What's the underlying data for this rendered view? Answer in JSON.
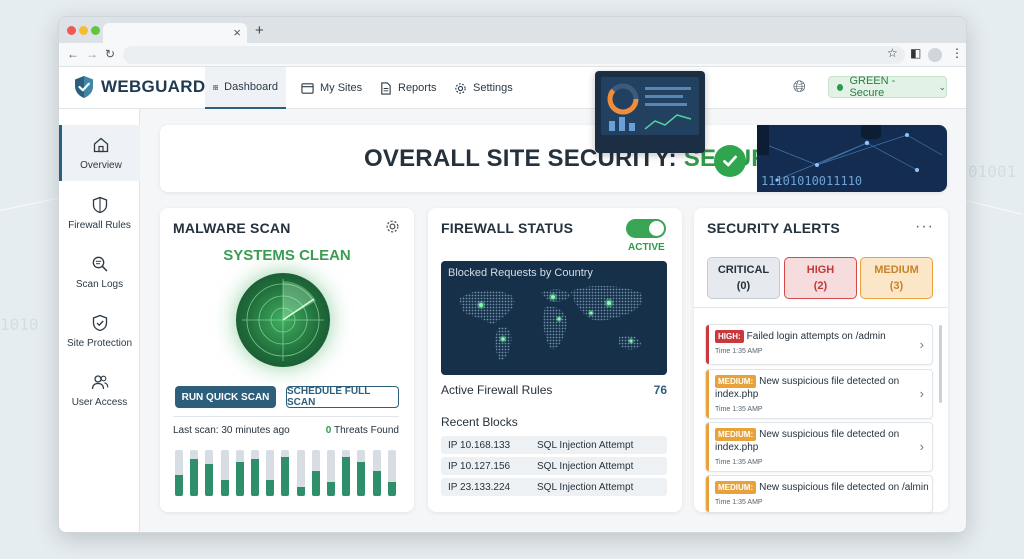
{
  "browser": {
    "tab_close": "×",
    "new_tab": "+"
  },
  "nav": {
    "brand": "WEBGUARD",
    "items": [
      {
        "label": "Dashboard"
      },
      {
        "label": "My Sites"
      },
      {
        "label": "Reports"
      },
      {
        "label": "Settings"
      }
    ],
    "status_label": "GREEN - Secure"
  },
  "sidebar": {
    "items": [
      {
        "label": "Overview"
      },
      {
        "label": "Firewall Rules"
      },
      {
        "label": "Scan Logs"
      },
      {
        "label": "Site Protection"
      },
      {
        "label": "User Access"
      }
    ]
  },
  "banner": {
    "title_prefix": "OVERALL SITE SECURITY: ",
    "status": "SECURE",
    "deco_bits": "11101010011110"
  },
  "malware": {
    "title": "MALWARE SCAN",
    "status": "SYSTEMS CLEAN",
    "quick_scan": "RUN QUICK SCAN",
    "full_scan": "SCHEDULE FULL SCAN",
    "last_scan": "Last scan: 30 minutes ago",
    "threats_count": "0",
    "threats_label": " Threats Found",
    "activity_levels": [
      0.45,
      0.8,
      0.7,
      0.35,
      0.75,
      0.8,
      0.35,
      0.85,
      0.2,
      0.55,
      0.3,
      0.85,
      0.75,
      0.55,
      0.3
    ]
  },
  "firewall": {
    "title": "FIREWALL STATUS",
    "toggle_state": "ACTIVE",
    "map_title": "Blocked Requests by Country",
    "rules_label": "Active Firewall Rules",
    "rules_count": "76",
    "recent_title": "Recent Blocks",
    "blocks": [
      {
        "ip": "IP 10.168.133",
        "type": "SQL Injection Attempt"
      },
      {
        "ip": "IP 10.127.156",
        "type": "SQL Injection Attempt"
      },
      {
        "ip": "IP 23.133.224",
        "type": "SQL Injection Attempt"
      }
    ]
  },
  "alerts": {
    "title": "SECURITY ALERTS",
    "more": "···",
    "severity": [
      {
        "label": "CRITICAL",
        "count": "(0)"
      },
      {
        "label": "HIGH",
        "count": "(2)"
      },
      {
        "label": "MEDIUM",
        "count": "(3)"
      }
    ],
    "items": [
      {
        "tag": "HIGH:",
        "text": "Failed login attempts on /admin",
        "time": "Time 1:35 AMP"
      },
      {
        "tag": "MEDIUM:",
        "text": "New suspicious file detected on index.php",
        "time": "Time 1:35 AMP"
      },
      {
        "tag": "MEDIUM:",
        "text": "New suspicious file detected on index.php",
        "time": "Time 1:35 AMP"
      },
      {
        "tag": "MEDIUM:",
        "text": "New suspicious file detected on /almin",
        "time": "Time 1:35 AMP"
      }
    ]
  },
  "colors": {
    "brand": "#1e3a52",
    "accent": "#2d5f7d",
    "secure_green": "#2f9a48",
    "high_red": "#c8383d",
    "medium_orange": "#e8a23b"
  }
}
